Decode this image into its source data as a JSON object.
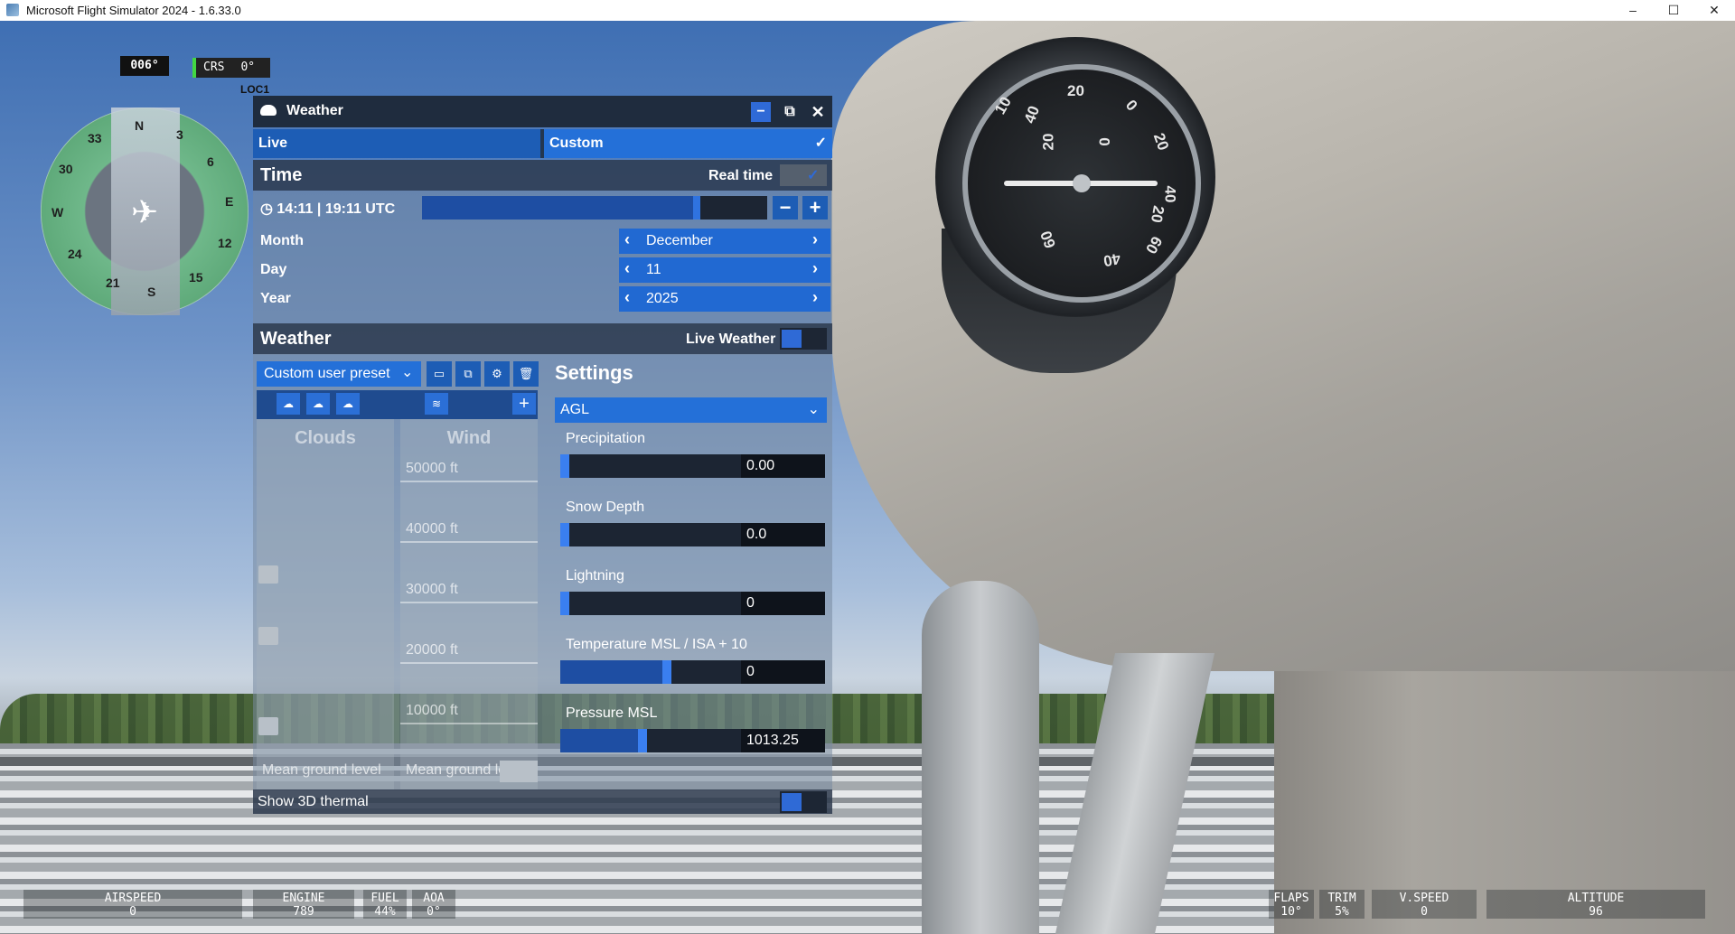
{
  "window": {
    "title": "Microsoft Flight Simulator 2024 - 1.6.33.0",
    "minimize": "–",
    "maximize": "☐",
    "close": "✕"
  },
  "nav": {
    "heading": "006°",
    "crs_label": "CRS",
    "crs_value": "0°",
    "loc_label": "LOC1",
    "compass_labels": [
      "N",
      "3",
      "6",
      "E",
      "12",
      "15",
      "S",
      "21",
      "24",
      "W",
      "30",
      "33"
    ]
  },
  "gauge": {
    "numbers": [
      "10",
      "20",
      "0",
      "20",
      "40",
      "60",
      "40",
      "20",
      "0",
      "20",
      "40",
      "60"
    ]
  },
  "weather_panel": {
    "title": "Weather",
    "tabs": {
      "live": "Live",
      "custom": "Custom",
      "custom_check": "✓"
    },
    "time_section": {
      "title": "Time",
      "real_time_label": "Real time",
      "real_time_checked": "✓",
      "time_text": "14:11 | 19:11 UTC",
      "minus": "−",
      "plus": "+"
    },
    "date": [
      {
        "label": "Month",
        "value": "December"
      },
      {
        "label": "Day",
        "value": "11"
      },
      {
        "label": "Year",
        "value": "2025"
      }
    ],
    "weather_section": {
      "title": "Weather",
      "live_weather_label": "Live Weather"
    },
    "preset": {
      "value": "Custom user preset",
      "arrow": "⌄"
    },
    "clouds_col": {
      "title": "Clouds",
      "ground": "Mean ground level"
    },
    "wind_col": {
      "title": "Wind",
      "altitudes": [
        "50000 ft",
        "40000 ft",
        "30000 ft",
        "20000 ft",
        "10000 ft"
      ],
      "ground": "Mean ground level"
    },
    "settings": {
      "title": "Settings",
      "reference": "AGL",
      "rows": [
        {
          "label": "Precipitation",
          "value": "0.00",
          "fraction": 0.0
        },
        {
          "label": "Snow Depth",
          "value": "0.0",
          "fraction": 0.0
        },
        {
          "label": "Lightning",
          "value": "0",
          "fraction": 0.0
        },
        {
          "label": "Temperature MSL / ISA + 10",
          "value": "0",
          "fraction": 0.5
        },
        {
          "label": "Pressure MSL",
          "value": "1013.25",
          "fraction": 0.5
        }
      ]
    },
    "footer": {
      "label": "Show 3D thermal"
    }
  },
  "hud": [
    {
      "label": "AIRSPEED",
      "value": "0"
    },
    {
      "label": "ENGINE",
      "value": "789"
    },
    {
      "label": "FUEL",
      "value": "44%"
    },
    {
      "label": "AOA",
      "value": "0°"
    },
    {
      "label": "FLAPS",
      "value": "10°"
    },
    {
      "label": "TRIM",
      "value": "5%"
    },
    {
      "label": "V.SPEED",
      "value": "0"
    },
    {
      "label": "ALTITUDE",
      "value": "96"
    }
  ],
  "colors": {
    "accent": "#2470d8",
    "panel_header": "#1f2c3e",
    "crs_marker": "#42d742"
  }
}
